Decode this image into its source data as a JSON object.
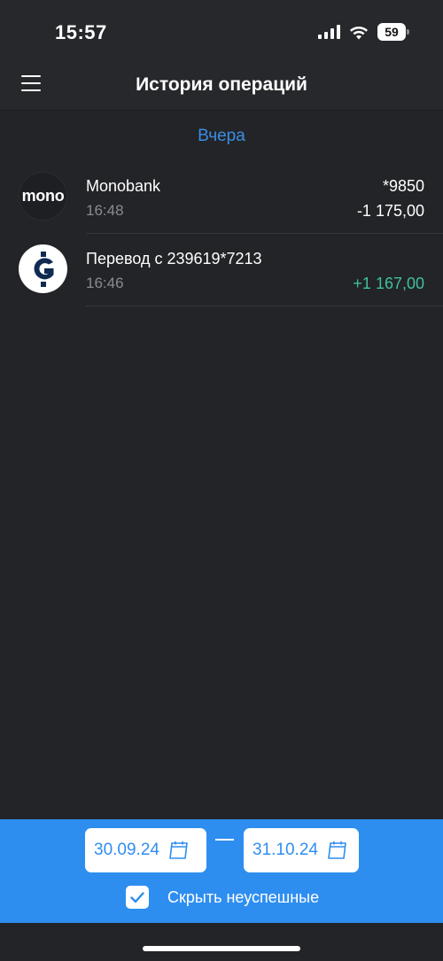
{
  "status_bar": {
    "time": "15:57",
    "battery": "59"
  },
  "header": {
    "title": "История операций"
  },
  "section": {
    "label": "Вчера"
  },
  "transactions": [
    {
      "avatar_text": "mono",
      "name": "Monobank",
      "time": "16:48",
      "card": "*9850",
      "amount": "-1 175,00"
    },
    {
      "avatar_icon": "g-coin-icon",
      "name": "Перевод с 239619*7213",
      "time": "16:46",
      "card": "",
      "amount": "+1 167,00"
    }
  ],
  "filter": {
    "date_from": "30.09.24",
    "date_to": "31.10.24",
    "hide_failed_label": "Скрыть неуспешные",
    "hide_failed_checked": true
  },
  "colors": {
    "accent": "#2e8ef0",
    "positive": "#3fc0a1",
    "background": "#232427"
  }
}
